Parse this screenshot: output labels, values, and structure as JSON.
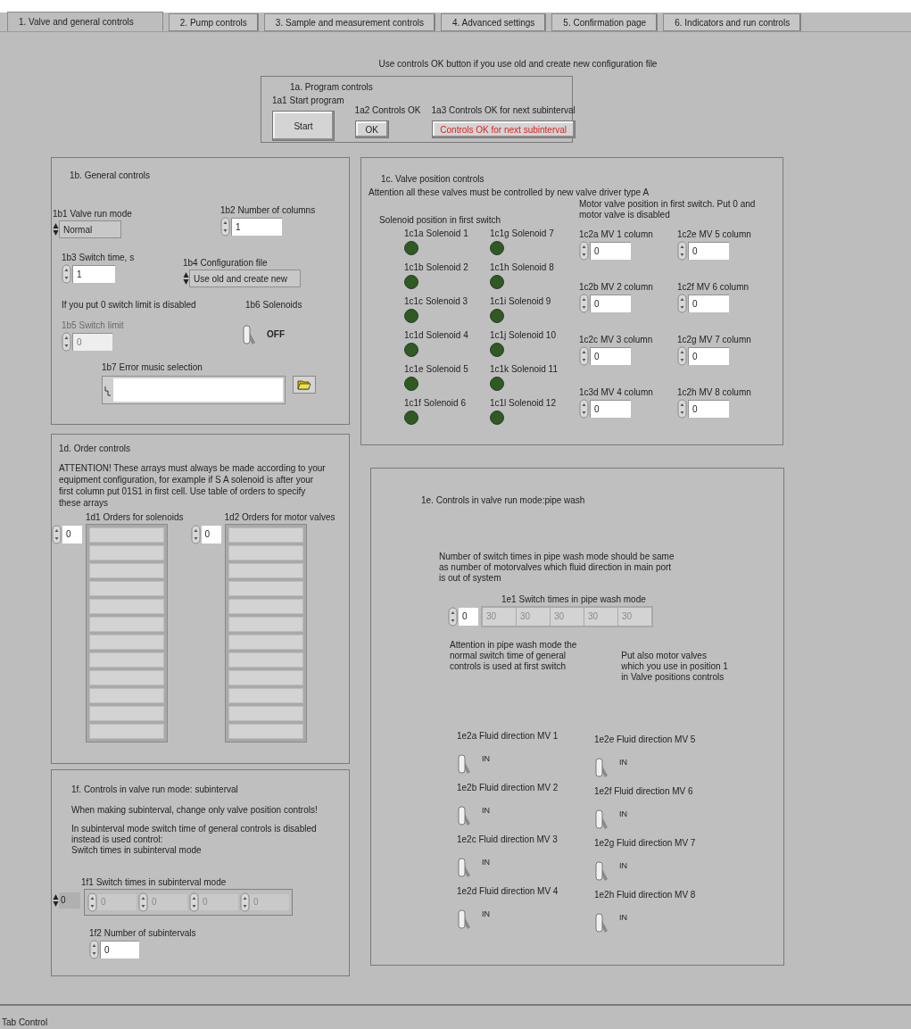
{
  "tabs": [
    {
      "label": "1. Valve and general controls",
      "selected": true
    },
    {
      "label": "2. Pump controls",
      "selected": false
    },
    {
      "label": "3. Sample and measurement controls",
      "selected": false
    },
    {
      "label": "4. Advanced settings",
      "selected": false
    },
    {
      "label": "5. Confirmation page",
      "selected": false
    },
    {
      "label": "6. Indicators and run controls",
      "selected": false
    }
  ],
  "top_note": "Use controls OK button if you use old and create new configuration file",
  "program_controls": {
    "title": "1a. Program controls",
    "start": {
      "label": "1a1 Start program",
      "button": "Start"
    },
    "controls_ok": {
      "label": "1a2 Controls OK",
      "button": "OK"
    },
    "next_subinterval": {
      "label": "1a3 Controls OK for next subinterval",
      "button": "Controls OK for next subinterval"
    }
  },
  "general_controls": {
    "title": "1b. General controls",
    "valve_run_mode": {
      "label": "1b1 Valve run mode",
      "value": "Normal"
    },
    "number_of_columns": {
      "label": "1b2 Number of columns",
      "value": "1",
      "disabled": false
    },
    "switch_time": {
      "label": "1b3 Switch time, s",
      "value": "1",
      "disabled": false
    },
    "configuration_file": {
      "label": "1b4 Configuration file",
      "value": "Use old and create new"
    },
    "switch_limit_note": "If you put 0 switch limit is disabled",
    "switch_limit": {
      "label": "1b5 Switch limit",
      "value": "0",
      "disabled": true
    },
    "solenoids": {
      "label": "1b6 Solenoids",
      "state": "OFF",
      "on": false
    },
    "error_music": {
      "label": "1b7 Error music selection"
    }
  },
  "valve_position": {
    "title": "1c. Valve position controls",
    "attention": "Attention all these valves  must be controlled by new valve driver type A",
    "motor_note": "Motor valve position in first switch. Put 0 and motor valve is disabled",
    "solenoid_heading": "Solenoid position in first switch",
    "solenoids": [
      {
        "label": "1c1a Solenoid 1",
        "on": false
      },
      {
        "label": "1c1b Solenoid 2",
        "on": false
      },
      {
        "label": "1c1c Solenoid 3",
        "on": false
      },
      {
        "label": "1c1d Solenoid 4",
        "on": false
      },
      {
        "label": "1c1e Solenoid 5",
        "on": false
      },
      {
        "label": "1c1f Solenoid 6",
        "on": false
      },
      {
        "label": "1c1g Solenoid 7",
        "on": false
      },
      {
        "label": "1c1h Solenoid 8",
        "on": false
      },
      {
        "label": "1c1i Solenoid 9",
        "on": false
      },
      {
        "label": "1c1j Solenoid 10",
        "on": false
      },
      {
        "label": "1c1k Solenoid 11",
        "on": false
      },
      {
        "label": "1c1l Solenoid 12",
        "on": false
      }
    ],
    "motor_valves": [
      {
        "label": "1c2a MV 1 column",
        "value": "0"
      },
      {
        "label": "1c2b MV 2 column",
        "value": "0"
      },
      {
        "label": "1c2c MV 3 column",
        "value": "0"
      },
      {
        "label": "1c3d MV 4 column",
        "value": "0"
      },
      {
        "label": "1c2e MV 5 column",
        "value": "0"
      },
      {
        "label": "1c2f MV 6 column",
        "value": "0"
      },
      {
        "label": "1c2g MV 7 column",
        "value": "0"
      },
      {
        "label": "1c2h MV 8 column",
        "value": "0"
      }
    ]
  },
  "order_controls": {
    "title": "1d. Order controls",
    "attention": "ATTENTION! These arrays must always be made according to your equipment configuration, for example if S A solenoid is after your first column put 01S1 in first cell. Use table of orders  to specify these arrays",
    "arrays": [
      {
        "label": "1d1 Orders for solenoids",
        "index": "0"
      },
      {
        "label": "1d2 Orders for motor valves",
        "index": "0"
      }
    ]
  },
  "pipe_wash": {
    "title": "1e. Controls in  valve run mode:pipe wash",
    "note": "Number of switch times in pipe wash mode should be same as number of motorvalves which fluid direction in main port  is out of system",
    "switch_times": {
      "label": "1e1 Switch times in pipe wash mode",
      "index": "0",
      "disabled": true,
      "values": [
        "30",
        "30",
        "30",
        "30",
        "30"
      ]
    },
    "attention": "Attention in pipe wash mode the\nnormal switch time of general\ncontrols is used  at first switch",
    "put_also": "Put also motor valves\nwhich you use in position 1\n in Valve positions controls",
    "fluid_directions": [
      {
        "label": "1e2a Fluid direction MV 1",
        "state": "IN",
        "on": false
      },
      {
        "label": "1e2b Fluid direction MV 2",
        "state": "IN",
        "on": false
      },
      {
        "label": "1e2c Fluid direction MV 3",
        "state": "IN",
        "on": false
      },
      {
        "label": "1e2d Fluid direction MV 4",
        "state": "IN",
        "on": false
      },
      {
        "label": "1e2e Fluid direction MV 5",
        "state": "IN",
        "on": false
      },
      {
        "label": "1e2f Fluid direction MV 6",
        "state": "IN",
        "on": false
      },
      {
        "label": "1e2g Fluid direction MV 7",
        "state": "IN",
        "on": false
      },
      {
        "label": "1e2h Fluid direction MV 8",
        "state": "IN",
        "on": false
      }
    ]
  },
  "subinterval": {
    "title": "1f. Controls in valve run mode: subinterval",
    "note": "When making subinterval, change only valve position controls!",
    "note2": "In subinterval mode switch time of general controls is disabled\ninstead is used control:\nSwitch times in subinterval mode",
    "switch_times": {
      "label": "1f1 Switch times in subinterval mode",
      "index": "0",
      "disabled": true,
      "values": [
        "0",
        "0",
        "0",
        "0"
      ]
    },
    "number": {
      "label": "1f2 Number of subintervals",
      "value": "0",
      "disabled": false
    }
  },
  "status_bar": "Tab Control"
}
